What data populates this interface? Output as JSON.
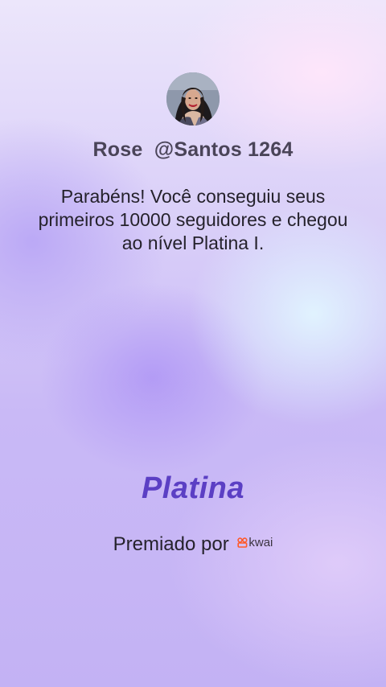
{
  "profile": {
    "name": "Rose",
    "handle": "@Santos 1264",
    "display": "Rose  @Santos 1264"
  },
  "message": "Parabéns! Você conseguiu seus primeiros 10000 seguidores e chegou ao nível Platina I.",
  "tier": "Platina",
  "awarded_by": "Premiado por",
  "brand": {
    "name": "kwai",
    "icon": "kwai-logo-icon",
    "color": "#ff5a2a"
  },
  "colors": {
    "tier_text": "#5b3fc4",
    "body_text": "#25222c",
    "username_text": "#4a4458"
  }
}
